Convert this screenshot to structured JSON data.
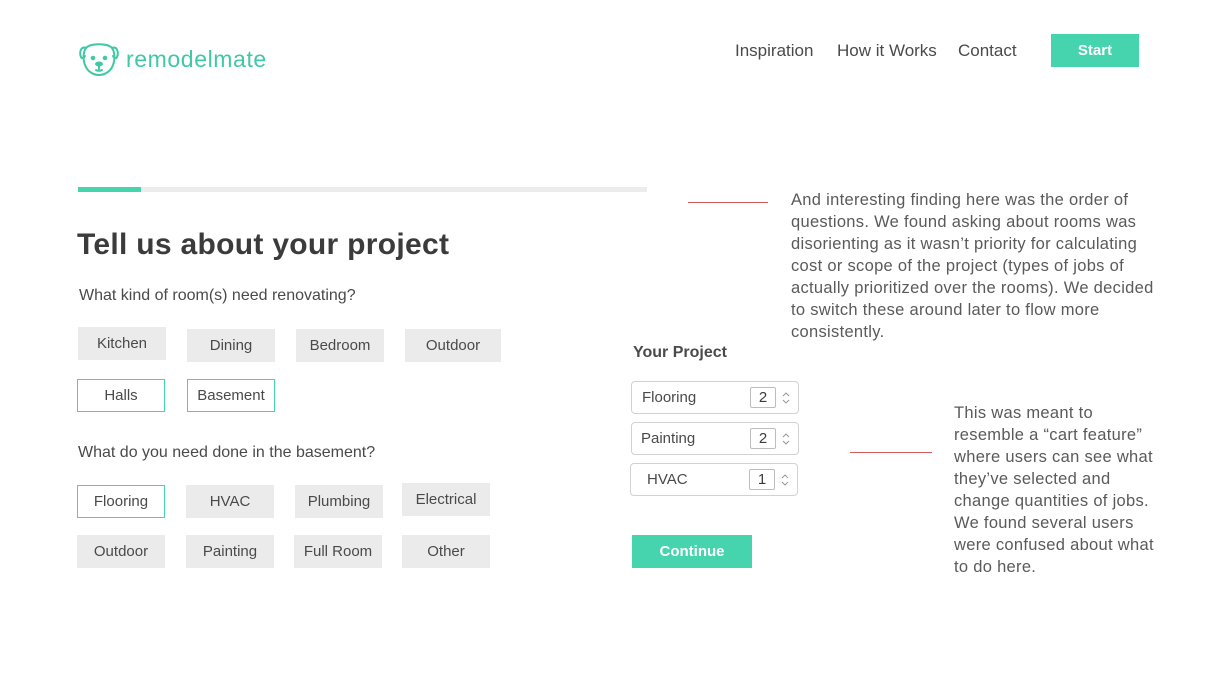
{
  "header": {
    "logo_text": "remodelmate",
    "nav": [
      "Inspiration",
      "How it Works",
      "Contact"
    ],
    "start_label": "Start"
  },
  "form": {
    "progress": 0.11,
    "title": "Tell us about your project",
    "question_rooms": "What kind of room(s) need renovating?",
    "rooms": [
      {
        "label": "Kitchen",
        "selected": false
      },
      {
        "label": "Dining",
        "selected": false
      },
      {
        "label": "Bedroom",
        "selected": false
      },
      {
        "label": "Outdoor",
        "selected": false
      },
      {
        "label": "Halls",
        "selected": true
      },
      {
        "label": "Basement",
        "selected": true
      }
    ],
    "question_jobs": "What do you need done in the basement?",
    "jobs": [
      {
        "label": "Flooring",
        "selected": true
      },
      {
        "label": "HVAC",
        "selected": false
      },
      {
        "label": "Plumbing",
        "selected": false
      },
      {
        "label": "Electrical",
        "selected": false
      },
      {
        "label": "Outdoor",
        "selected": false
      },
      {
        "label": "Painting",
        "selected": false
      },
      {
        "label": "Full Room",
        "selected": false
      },
      {
        "label": "Other",
        "selected": false
      }
    ]
  },
  "project": {
    "title": "Your Project",
    "items": [
      {
        "label": "Flooring",
        "qty": "2"
      },
      {
        "label": "Painting",
        "qty": "2"
      },
      {
        "label": "HVAC",
        "qty": "1"
      }
    ],
    "continue_label": "Continue"
  },
  "annotations": {
    "note1": "And interesting finding here was the order of questions. We found asking about rooms was disorienting as it wasn’t priority for calculating cost or scope of the project (types of jobs of actually prioritized over the rooms). We decided to switch these around later to flow more consistently.",
    "note2": "This was meant to resemble a “cart feature” where users can see what they’ve selected and change quantities of jobs. We found several users were confused about what to do here."
  },
  "colors": {
    "accent": "#45d4ae",
    "annotation_line": "#d25a5a",
    "chip_bg": "#ebebeb"
  },
  "icons": {
    "logo": "dog-face-icon",
    "spinner": "up-down-arrows-icon"
  }
}
